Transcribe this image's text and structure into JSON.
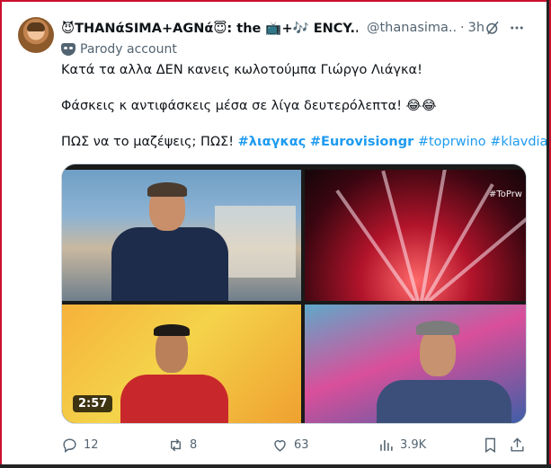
{
  "tweet": {
    "display_name": "😈THANάSIMA+AGNά😇: the 📺+🎶 ENCY...",
    "handle": "@thanasima...",
    "dot": "·",
    "time": "3h",
    "parody_label": "Parody account",
    "line1": "Κατά τα αλλα ΔΕΝ κανεις κωλοτούμπα Γιώργο Λιάγκα!",
    "line2": "Φάσκεις κ αντιφάσκεις μέσα σε λίγα δευτερόλεπτα! 😂😂",
    "line3_text": "ΠΩΣ να το μαζέψεις; ΠΩΣ!",
    "hashtags": [
      "#λιαγκας",
      "#Eurovisiongr",
      "#toprwino",
      "#klavdia"
    ]
  },
  "media": {
    "duration": "2:57",
    "channel_label": "#ToPrw"
  },
  "actions": {
    "replies": "12",
    "reposts": "8",
    "likes": "63",
    "views": "3.9K"
  },
  "icons": [
    "grok-icon",
    "more-icon",
    "parody-mask-icon",
    "reply-icon",
    "repost-icon",
    "like-icon",
    "views-icon",
    "bookmark-icon",
    "share-icon"
  ]
}
